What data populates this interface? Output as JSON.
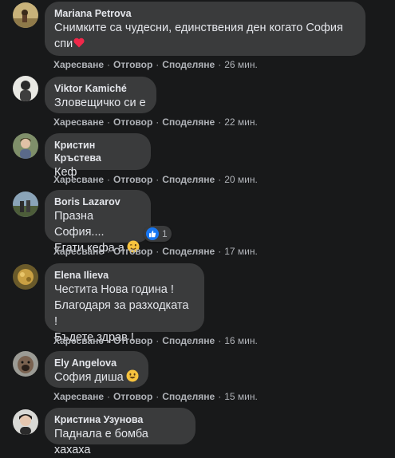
{
  "actions": {
    "like": "Харесване",
    "reply": "Отговор",
    "share": "Споделяне"
  },
  "comments": [
    {
      "author": "Mariana Petrova",
      "lines": [
        "Снимките са чудесни, единствения ден когато София",
        "спи"
      ],
      "emoji": "heart-emoji",
      "time": "26 мин."
    },
    {
      "author": "Viktor Kamiché",
      "lines": [
        "Зловещичко си е"
      ],
      "time": "22 мин."
    },
    {
      "author": "Кристин Кръстева",
      "lines": [
        "Кеф"
      ],
      "time": "20 мин."
    },
    {
      "author": "Boris Lazarov",
      "lines": [
        "Празна София....",
        "Егати кефа а"
      ],
      "emoji": "winking-face-emoji",
      "reactions": {
        "icon": "like-icon",
        "count": "1"
      },
      "time": "17 мин."
    },
    {
      "author": "Elena Ilieva",
      "lines": [
        "Честита Нова година !",
        "Благодаря за разходката !",
        "Бъдете здрав !"
      ],
      "time": "16 мин."
    },
    {
      "author": "Ely Angelova",
      "lines": [
        "София диша"
      ],
      "emoji": "smiling-face-emoji",
      "time": "15 мин."
    },
    {
      "author": "Кристина Узунова",
      "lines": [
        "Паднала е бомба хахаха"
      ]
    }
  ]
}
